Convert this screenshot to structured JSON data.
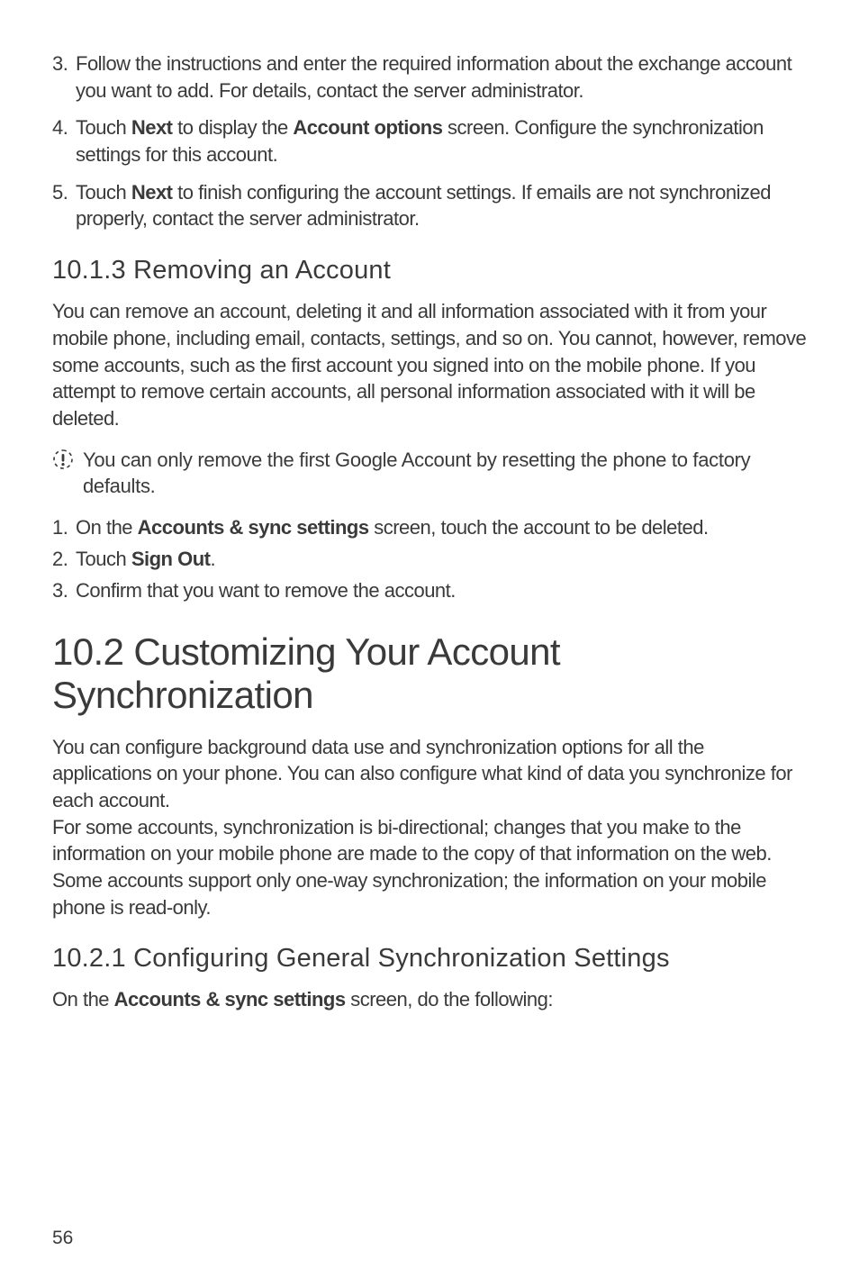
{
  "list1": {
    "item3": {
      "num": "3.",
      "pre": "Follow the instructions and enter the required information about the exchange account you want to add. For details, contact the server administrator."
    },
    "item4": {
      "num": "4.",
      "a": "Touch ",
      "b1": "Next",
      "c": " to display the ",
      "b2": "Account options",
      "d": " screen. Configure the synchronization settings for this account."
    },
    "item5": {
      "num": "5.",
      "a": "Touch ",
      "b1": "Next",
      "c": " to finish configuring the account settings. If emails are not synchronized properly, contact the server administrator."
    }
  },
  "h3_1": "10.1.3   Removing an Account",
  "para1": "You can remove an account, deleting it and all information associated with it from your mobile phone, including email, contacts, settings, and so on. You cannot, however, remove some accounts, such as the first account you signed into on the mobile phone. If you attempt to remove certain accounts, all personal information associated with it will be deleted.",
  "note1": "You can only remove the first Google Account by resetting the phone to factory defaults.",
  "list2": {
    "item1": {
      "num": "1.",
      "a": "On the ",
      "b1": "Accounts & sync settings",
      "c": " screen, touch the account to be deleted."
    },
    "item2": {
      "num": "2.",
      "a": "Touch ",
      "b1": "Sign Out",
      "c": "."
    },
    "item3": {
      "num": "3.",
      "a": "Confirm that you want to remove the account."
    }
  },
  "h2": "10.2  Customizing Your Account Synchronization",
  "para2": "You can configure background data use and synchronization options for all the applications on your phone. You can also configure what kind of data you synchronize for each account.",
  "para3": "For some accounts, synchronization is bi-directional; changes that you make to the information on your mobile phone are made to the copy of that information on the web. Some accounts support only one-way synchronization; the information on your mobile phone is read-only.",
  "h3_2": "10.2.1   Configuring General Synchronization Settings",
  "para4": {
    "a": "On the ",
    "b1": "Accounts & sync settings",
    "c": " screen, do the following:"
  },
  "page_num": "56"
}
